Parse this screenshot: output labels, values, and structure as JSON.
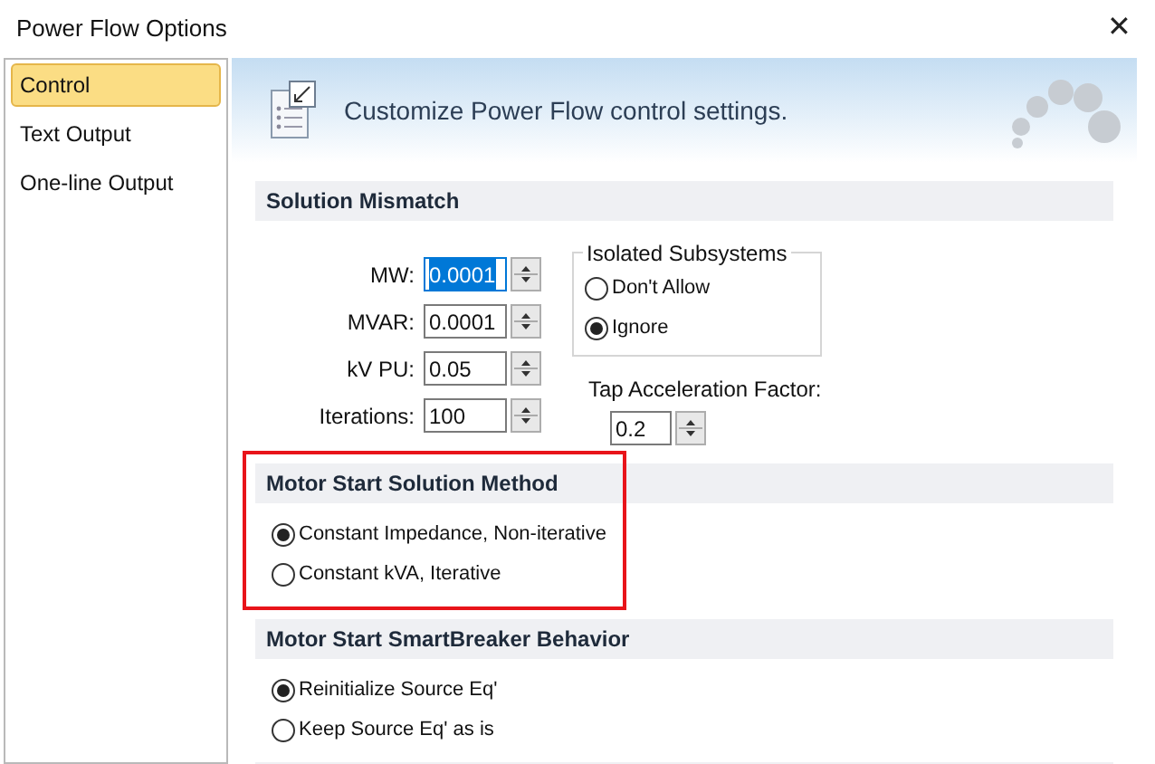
{
  "window": {
    "title": "Power Flow Options",
    "close": "✕"
  },
  "sidebar": {
    "items": [
      {
        "label": "Control",
        "selected": true
      },
      {
        "label": "Text Output",
        "selected": false
      },
      {
        "label": "One-line Output",
        "selected": false
      }
    ]
  },
  "header": {
    "text": "Customize Power Flow control settings."
  },
  "solution_mismatch": {
    "title": "Solution Mismatch",
    "fields": [
      {
        "label": "MW:",
        "value": "0.0001",
        "focused": true
      },
      {
        "label": "MVAR:",
        "value": "0.0001",
        "focused": false
      },
      {
        "label": "kV PU:",
        "value": "0.05",
        "focused": false
      },
      {
        "label": "Iterations:",
        "value": "100",
        "focused": false
      }
    ],
    "isolated_subsystems": {
      "title": "Isolated Subsystems",
      "options": [
        {
          "label": "Don't Allow",
          "selected": false
        },
        {
          "label": "Ignore",
          "selected": true
        }
      ]
    },
    "tap_acceleration": {
      "label": "Tap Acceleration Factor:",
      "value": "0.2"
    }
  },
  "sections": [
    {
      "title": "Motor Start Solution Method",
      "highlighted": true,
      "options": [
        {
          "label": "Constant Impedance, Non-iterative",
          "selected": true
        },
        {
          "label": "Constant kVA, Iterative",
          "selected": false
        }
      ]
    },
    {
      "title": "Motor Start SmartBreaker Behavior",
      "highlighted": false,
      "options": [
        {
          "label": "Reinitialize Source Eq'",
          "selected": true
        },
        {
          "label": "Keep Source Eq' as is",
          "selected": false
        }
      ]
    }
  ]
}
